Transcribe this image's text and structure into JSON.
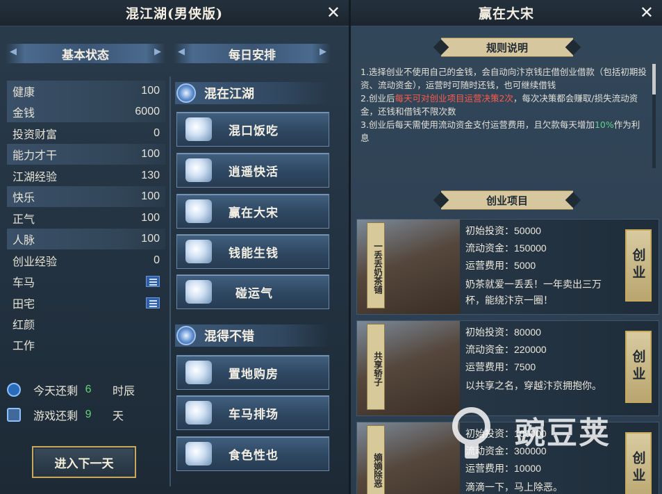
{
  "left": {
    "title": "混江湖(男侠版)",
    "status_header": "基本状态",
    "schedule_header": "每日安排",
    "stats": [
      {
        "label": "健康",
        "value": "100"
      },
      {
        "label": "金钱",
        "value": "6000"
      },
      {
        "label": "投资财富",
        "value": "0"
      },
      {
        "label": "能力才干",
        "value": "100"
      },
      {
        "label": "江湖经验",
        "value": "130"
      },
      {
        "label": "快乐",
        "value": "100"
      },
      {
        "label": "正气",
        "value": "100"
      },
      {
        "label": "人脉",
        "value": "100"
      },
      {
        "label": "创业经验",
        "value": "0"
      },
      {
        "label": "车马",
        "value": ""
      },
      {
        "label": "田宅",
        "value": ""
      },
      {
        "label": "红颜",
        "value": ""
      },
      {
        "label": "工作",
        "value": ""
      }
    ],
    "today": {
      "label": "今天还剩",
      "value": "6",
      "unit": "时辰"
    },
    "game": {
      "label": "游戏还剩",
      "value": "9",
      "unit": "天"
    },
    "next_day": "进入下一天",
    "cat1": "混在江湖",
    "cat1_items": [
      "混口饭吃",
      "逍遥快活",
      "赢在大宋",
      "钱能生钱",
      "碰运气"
    ],
    "cat2": "混得不错",
    "cat2_items": [
      "置地购房",
      "车马排场",
      "食色性也"
    ]
  },
  "right": {
    "title": "赢在大宋",
    "rules_title": "规则说明",
    "rule1": "1.选择创业不使用自己的金钱，会自动向汴京钱庄借创业借款（包括初期投资、流动资金），运营时可随时还钱，也可继续借钱",
    "rule2a": "2.创业后",
    "rule2b": "每天可对创业项目运营决策2次",
    "rule2c": "，每次决策都会赚取/损失流动资金，还钱和借钱不限次数",
    "rule3a": "3.创业后每天需使用流动资金支付运营费用，且欠款每天增加",
    "rule3b": "10%",
    "rule3c": "作为利息",
    "projects_title": "创业项目",
    "go_label": "创业",
    "projects": [
      {
        "name": "一丢丢奶茶铺",
        "invest": "初始投资：50000",
        "flow": "流动资金：150000",
        "cost": "运营费用：5000",
        "desc": "奶茶就爱一丢丢！一年卖出三万杯，能绕汴京一圈！"
      },
      {
        "name": "共享轿子",
        "invest": "初始投资：80000",
        "flow": "流动资金：220000",
        "cost": "运营费用：7500",
        "desc": "以共享之名，穿越汴京拥抱你。"
      },
      {
        "name": "嫡嫡除恶",
        "invest": "初始投资：100000",
        "flow": "流动资金：300000",
        "cost": "运营费用：10000",
        "desc": "滴滴一下，马上除恶。"
      }
    ]
  },
  "watermark": "豌豆荚"
}
